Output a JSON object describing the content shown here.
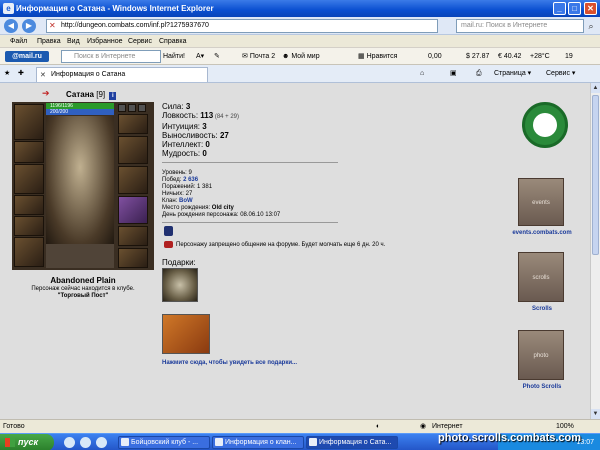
{
  "window": {
    "title": "Информация о Сатана - Windows Internet Explorer",
    "minimize": "_",
    "maximize": "□",
    "close": "✕"
  },
  "address": {
    "back": "◀",
    "forward": "▶",
    "url": "http://dungeon.combats.com/inf.pl?1275937670",
    "search_placeholder": "mail.ru: Поиск в Интернете",
    "search_icon": "search-icon"
  },
  "menu": [
    "Файл",
    "Правка",
    "Вид",
    "Избранное",
    "Сервис",
    "Справка"
  ],
  "mailbar": {
    "logo": "@mail.ru",
    "search_placeholder": "Поиск в Интернете",
    "go": "Найти!",
    "mail": "Почта 2",
    "myworld": "Мой мир",
    "like": "Нравится",
    "money": "0,00",
    "usd": "$ 27.87",
    "eur": "€ 40.42",
    "temp": "+28°C",
    "count": "19"
  },
  "tabs": {
    "active": "Информация о Сатана",
    "page_menu": "Страница ▾",
    "tools_menu": "Сервис ▾"
  },
  "character": {
    "name": "Сатана",
    "level": "[9]",
    "info_badge": "i",
    "hp": "1196/1196",
    "mp": "200/200",
    "location": "Abandoned Plain",
    "club_line": "Персонаж сейчас находится в клубе.",
    "club_name": "\"Торговый Пост\""
  },
  "stats": [
    {
      "label": "Сила: ",
      "value": "3",
      "extra": ""
    },
    {
      "label": "Ловкость: ",
      "value": "113",
      "extra": " (84 + 29)"
    },
    {
      "label": "Интуиция: ",
      "value": "3",
      "extra": ""
    },
    {
      "label": "Выносливость: ",
      "value": "27",
      "extra": ""
    },
    {
      "label": "Интеллект: ",
      "value": "0",
      "extra": ""
    },
    {
      "label": "Мудрость: ",
      "value": "0",
      "extra": ""
    }
  ],
  "info": {
    "level": "Уровень: 9",
    "wins_label": "Побед: ",
    "wins": "2 636",
    "losses": "Поражений: 1 381",
    "draws": "Ничьих: 27",
    "clan_label": "Клан: ",
    "clan": "BoW",
    "birthplace_label": "Место рождения: ",
    "birthplace": "Old city",
    "birthday": "День рождения персонажа: 08.06.10 13:07"
  },
  "forum_ban": "Персонажу запрещено общение на форуме. Будет молчать еще 6 дн. 20 ч.",
  "gifts": {
    "title": "Подарки:",
    "see_all": "Нажмите сюда, чтобы увидеть все подарки..."
  },
  "sidebar": {
    "events": "events.combats.com",
    "events_banner": "events",
    "scrolls": "Scrolls",
    "scrolls_banner": "scrolls",
    "photo": "Photo Scrolls",
    "photo_banner": "photo"
  },
  "status": {
    "left": "Готово",
    "zone": "Интернет",
    "zoom": "100%"
  },
  "taskbar": {
    "start": "пуск",
    "items": [
      "Бойцовский клуб - ...",
      "Информация о клан...",
      "Информация о Сата..."
    ],
    "clock": "13:07"
  },
  "watermark": "photo.scrolls.combats.com",
  "colors": {
    "title_blue": "#0a4fd0",
    "content_bg": "#dedede",
    "link": "#1a3a9a",
    "hp_green": "#2a9a2a",
    "mp_blue": "#3060c0"
  }
}
